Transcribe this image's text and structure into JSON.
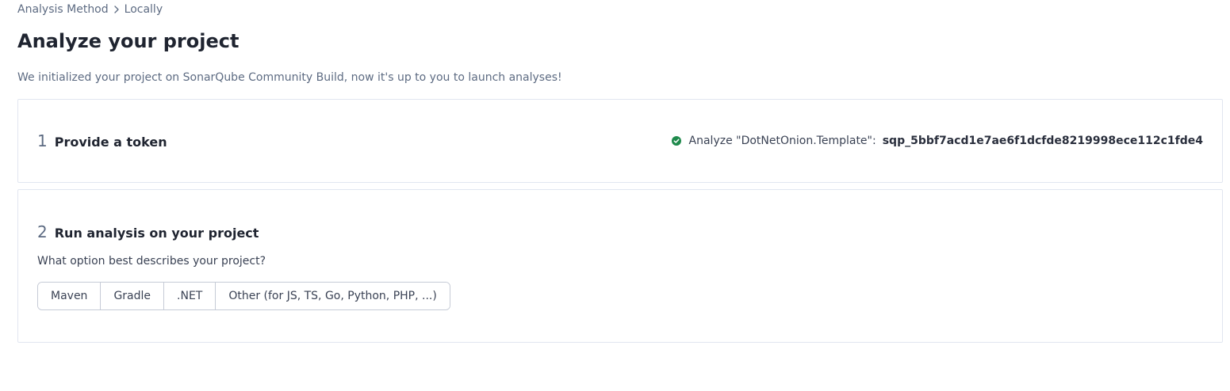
{
  "breadcrumb": {
    "items": [
      "Analysis Method",
      "Locally"
    ]
  },
  "page": {
    "title": "Analyze your project",
    "intro": "We initialized your project on SonarQube Community Build, now it's up to you to launch analyses!"
  },
  "step1": {
    "number": "1",
    "title": "Provide a token",
    "token_label": "Analyze \"DotNetOnion.Template\":",
    "token_value": "sqp_5bbf7acd1e7ae6f1dcfde8219998ece112c1fde4",
    "status_icon": "check-circle-icon",
    "status_color": "#1f8a4c"
  },
  "step2": {
    "number": "2",
    "title": "Run analysis on your project",
    "question": "What option best describes your project?",
    "options": [
      "Maven",
      "Gradle",
      ".NET",
      "Other (for JS, TS, Go, Python, PHP, ...)"
    ]
  }
}
